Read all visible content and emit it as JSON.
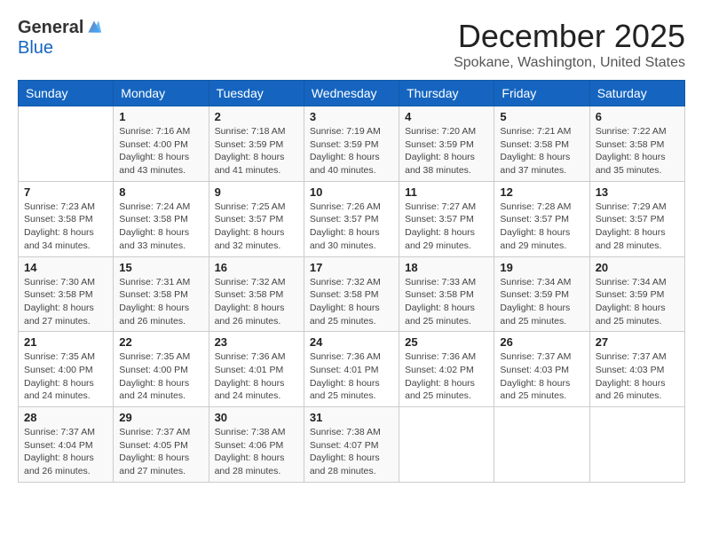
{
  "logo": {
    "general": "General",
    "blue": "Blue"
  },
  "header": {
    "month": "December 2025",
    "location": "Spokane, Washington, United States"
  },
  "weekdays": [
    "Sunday",
    "Monday",
    "Tuesday",
    "Wednesday",
    "Thursday",
    "Friday",
    "Saturday"
  ],
  "weeks": [
    [
      {
        "day": "",
        "info": ""
      },
      {
        "day": "1",
        "info": "Sunrise: 7:16 AM\nSunset: 4:00 PM\nDaylight: 8 hours\nand 43 minutes."
      },
      {
        "day": "2",
        "info": "Sunrise: 7:18 AM\nSunset: 3:59 PM\nDaylight: 8 hours\nand 41 minutes."
      },
      {
        "day": "3",
        "info": "Sunrise: 7:19 AM\nSunset: 3:59 PM\nDaylight: 8 hours\nand 40 minutes."
      },
      {
        "day": "4",
        "info": "Sunrise: 7:20 AM\nSunset: 3:59 PM\nDaylight: 8 hours\nand 38 minutes."
      },
      {
        "day": "5",
        "info": "Sunrise: 7:21 AM\nSunset: 3:58 PM\nDaylight: 8 hours\nand 37 minutes."
      },
      {
        "day": "6",
        "info": "Sunrise: 7:22 AM\nSunset: 3:58 PM\nDaylight: 8 hours\nand 35 minutes."
      }
    ],
    [
      {
        "day": "7",
        "info": "Sunrise: 7:23 AM\nSunset: 3:58 PM\nDaylight: 8 hours\nand 34 minutes."
      },
      {
        "day": "8",
        "info": "Sunrise: 7:24 AM\nSunset: 3:58 PM\nDaylight: 8 hours\nand 33 minutes."
      },
      {
        "day": "9",
        "info": "Sunrise: 7:25 AM\nSunset: 3:57 PM\nDaylight: 8 hours\nand 32 minutes."
      },
      {
        "day": "10",
        "info": "Sunrise: 7:26 AM\nSunset: 3:57 PM\nDaylight: 8 hours\nand 30 minutes."
      },
      {
        "day": "11",
        "info": "Sunrise: 7:27 AM\nSunset: 3:57 PM\nDaylight: 8 hours\nand 29 minutes."
      },
      {
        "day": "12",
        "info": "Sunrise: 7:28 AM\nSunset: 3:57 PM\nDaylight: 8 hours\nand 29 minutes."
      },
      {
        "day": "13",
        "info": "Sunrise: 7:29 AM\nSunset: 3:57 PM\nDaylight: 8 hours\nand 28 minutes."
      }
    ],
    [
      {
        "day": "14",
        "info": "Sunrise: 7:30 AM\nSunset: 3:58 PM\nDaylight: 8 hours\nand 27 minutes."
      },
      {
        "day": "15",
        "info": "Sunrise: 7:31 AM\nSunset: 3:58 PM\nDaylight: 8 hours\nand 26 minutes."
      },
      {
        "day": "16",
        "info": "Sunrise: 7:32 AM\nSunset: 3:58 PM\nDaylight: 8 hours\nand 26 minutes."
      },
      {
        "day": "17",
        "info": "Sunrise: 7:32 AM\nSunset: 3:58 PM\nDaylight: 8 hours\nand 25 minutes."
      },
      {
        "day": "18",
        "info": "Sunrise: 7:33 AM\nSunset: 3:58 PM\nDaylight: 8 hours\nand 25 minutes."
      },
      {
        "day": "19",
        "info": "Sunrise: 7:34 AM\nSunset: 3:59 PM\nDaylight: 8 hours\nand 25 minutes."
      },
      {
        "day": "20",
        "info": "Sunrise: 7:34 AM\nSunset: 3:59 PM\nDaylight: 8 hours\nand 25 minutes."
      }
    ],
    [
      {
        "day": "21",
        "info": "Sunrise: 7:35 AM\nSunset: 4:00 PM\nDaylight: 8 hours\nand 24 minutes."
      },
      {
        "day": "22",
        "info": "Sunrise: 7:35 AM\nSunset: 4:00 PM\nDaylight: 8 hours\nand 24 minutes."
      },
      {
        "day": "23",
        "info": "Sunrise: 7:36 AM\nSunset: 4:01 PM\nDaylight: 8 hours\nand 24 minutes."
      },
      {
        "day": "24",
        "info": "Sunrise: 7:36 AM\nSunset: 4:01 PM\nDaylight: 8 hours\nand 25 minutes."
      },
      {
        "day": "25",
        "info": "Sunrise: 7:36 AM\nSunset: 4:02 PM\nDaylight: 8 hours\nand 25 minutes."
      },
      {
        "day": "26",
        "info": "Sunrise: 7:37 AM\nSunset: 4:03 PM\nDaylight: 8 hours\nand 25 minutes."
      },
      {
        "day": "27",
        "info": "Sunrise: 7:37 AM\nSunset: 4:03 PM\nDaylight: 8 hours\nand 26 minutes."
      }
    ],
    [
      {
        "day": "28",
        "info": "Sunrise: 7:37 AM\nSunset: 4:04 PM\nDaylight: 8 hours\nand 26 minutes."
      },
      {
        "day": "29",
        "info": "Sunrise: 7:37 AM\nSunset: 4:05 PM\nDaylight: 8 hours\nand 27 minutes."
      },
      {
        "day": "30",
        "info": "Sunrise: 7:38 AM\nSunset: 4:06 PM\nDaylight: 8 hours\nand 28 minutes."
      },
      {
        "day": "31",
        "info": "Sunrise: 7:38 AM\nSunset: 4:07 PM\nDaylight: 8 hours\nand 28 minutes."
      },
      {
        "day": "",
        "info": ""
      },
      {
        "day": "",
        "info": ""
      },
      {
        "day": "",
        "info": ""
      }
    ]
  ]
}
